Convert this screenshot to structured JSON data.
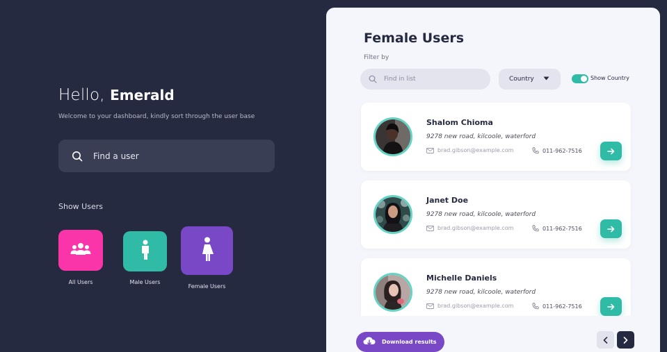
{
  "colors": {
    "background": "#262a41",
    "accent_teal": "#30bba7",
    "accent_pink": "#f935a9",
    "accent_purple": "#7848c6"
  },
  "greeting": {
    "hello": "Hello,",
    "name": "Emerald"
  },
  "welcome_text": "Welcome to your dashboard, kindly sort through the user base",
  "main_search": {
    "placeholder": "Find a user",
    "icon": "search-icon"
  },
  "show_users": {
    "heading": "Show Users",
    "tiles": [
      {
        "label": "All Users",
        "icon": "users-group-icon",
        "color": "#f935a9"
      },
      {
        "label": "Male Users",
        "icon": "male-user-icon",
        "color": "#30bba7"
      },
      {
        "label": "Female Users",
        "icon": "female-user-icon",
        "color": "#7848c6"
      }
    ]
  },
  "panel": {
    "title": "Female Users",
    "filter_label": "Filter by",
    "list_search_placeholder": "Find in list",
    "country_select": "Country",
    "show_country_label": "Show Country",
    "show_country_on": true
  },
  "users": [
    {
      "name": "Shalom Chioma",
      "address": "9278 new road, kilcoole, waterford",
      "email": "brad.gibson@example.com",
      "phone": "011-962-7516"
    },
    {
      "name": "Janet Doe",
      "address": "9278 new road, kilcoole, waterford",
      "email": "brad.gibson@example.com",
      "phone": "011-962-7516"
    },
    {
      "name": "Michelle Daniels",
      "address": "9278 new road, kilcoole, waterford",
      "email": "brad.gibson@example.com",
      "phone": "011-962-7516"
    }
  ],
  "footer": {
    "download_label": "Download results",
    "prev_icon": "chevron-left-icon",
    "next_icon": "chevron-right-icon"
  }
}
